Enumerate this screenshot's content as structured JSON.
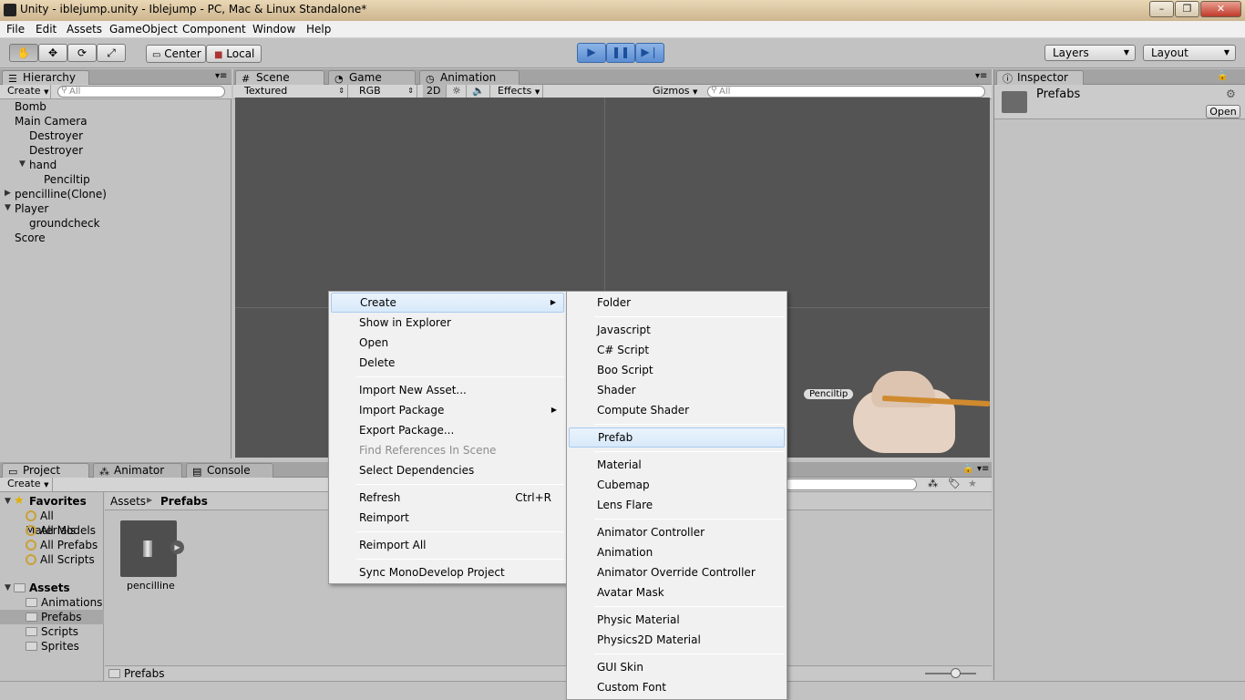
{
  "window": {
    "title": "Unity - iblejump.unity - Iblejump - PC, Mac & Linux Standalone*"
  },
  "menubar": [
    "File",
    "Edit",
    "Assets",
    "GameObject",
    "Component",
    "Window",
    "Help"
  ],
  "toolbar": {
    "pivot": "Center",
    "space": "Local",
    "layers": "Layers",
    "layout": "Layout"
  },
  "hierarchy": {
    "tab": "Hierarchy",
    "create": "Create",
    "search_placeholder": "All",
    "items": [
      "Bomb",
      "Main Camera",
      "Destroyer",
      "Destroyer",
      "hand",
      "Penciltip",
      "pencilline(Clone)",
      "Player",
      "groundcheck",
      "Score"
    ]
  },
  "scene": {
    "tabs": [
      "Scene",
      "Game",
      "Animation"
    ],
    "shading": "Textured",
    "color_mode": "RGB",
    "mode_2d": "2D",
    "effects": "Effects",
    "gizmos": "Gizmos",
    "search_placeholder": "All",
    "object_label": "Penciltip"
  },
  "inspector": {
    "tab": "Inspector",
    "name": "Prefabs",
    "open": "Open"
  },
  "project": {
    "tabs": [
      "Project",
      "Animator",
      "Console"
    ],
    "create": "Create",
    "favorites_label": "Favorites",
    "favorites": [
      "All Materials",
      "All Models",
      "All Prefabs",
      "All Scripts"
    ],
    "assets_label": "Assets",
    "folders": [
      "Animations",
      "Prefabs",
      "Scripts",
      "Sprites"
    ],
    "breadcrumb_root": "Assets",
    "breadcrumb_current": "Prefabs",
    "asset_name": "pencilline",
    "footer_path": "Prefabs"
  },
  "context_menu": {
    "items": [
      {
        "label": "Create",
        "submenu": true,
        "highlighted": true
      },
      {
        "label": "Show in Explorer"
      },
      {
        "label": "Open"
      },
      {
        "label": "Delete"
      },
      {
        "label": "Import New Asset..."
      },
      {
        "label": "Import Package",
        "submenu": true
      },
      {
        "label": "Export Package..."
      },
      {
        "label": "Find References In Scene",
        "disabled": true
      },
      {
        "label": "Select Dependencies"
      },
      {
        "label": "Refresh",
        "shortcut": "Ctrl+R"
      },
      {
        "label": "Reimport"
      },
      {
        "label": "Reimport All"
      },
      {
        "label": "Sync MonoDevelop Project"
      }
    ]
  },
  "create_submenu": {
    "items": [
      "Folder",
      "Javascript",
      "C# Script",
      "Boo Script",
      "Shader",
      "Compute Shader",
      "Prefab",
      "Material",
      "Cubemap",
      "Lens Flare",
      "Animator Controller",
      "Animation",
      "Animator Override Controller",
      "Avatar Mask",
      "Physic Material",
      "Physics2D Material",
      "GUI Skin",
      "Custom Font"
    ],
    "highlighted": "Prefab"
  }
}
